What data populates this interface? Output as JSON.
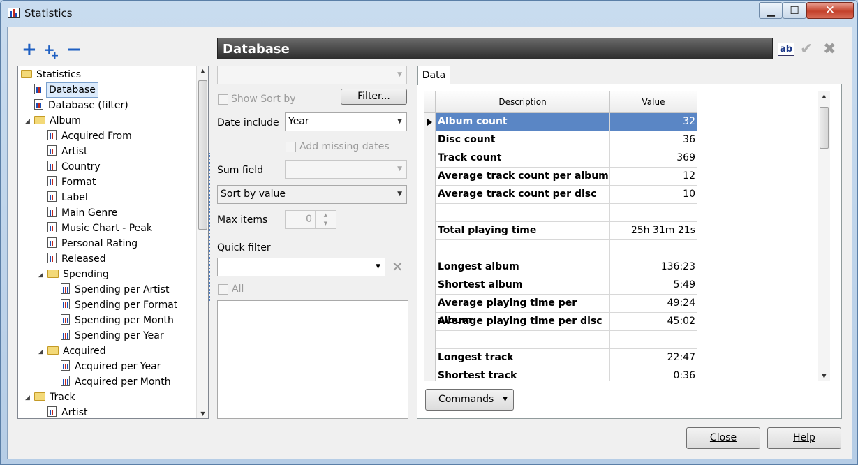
{
  "window": {
    "title": "Statistics"
  },
  "toolbar": {
    "add": "+",
    "add_sub": "+",
    "remove": "−"
  },
  "tree": {
    "items": [
      {
        "label": "Statistics",
        "level": 0,
        "type": "folder"
      },
      {
        "label": "Database",
        "level": 1,
        "type": "chart",
        "selected": true
      },
      {
        "label": "Database (filter)",
        "level": 1,
        "type": "chart"
      },
      {
        "label": "Album",
        "level": 1,
        "type": "folder"
      },
      {
        "label": "Acquired From",
        "level": 2,
        "type": "chart"
      },
      {
        "label": "Artist",
        "level": 2,
        "type": "chart"
      },
      {
        "label": "Country",
        "level": 2,
        "type": "chart"
      },
      {
        "label": "Format",
        "level": 2,
        "type": "chart"
      },
      {
        "label": "Label",
        "level": 2,
        "type": "chart"
      },
      {
        "label": "Main Genre",
        "level": 2,
        "type": "chart"
      },
      {
        "label": "Music Chart - Peak",
        "level": 2,
        "type": "chart"
      },
      {
        "label": "Personal Rating",
        "level": 2,
        "type": "chart"
      },
      {
        "label": "Released",
        "level": 2,
        "type": "chart"
      },
      {
        "label": "Spending",
        "level": 2,
        "type": "folder"
      },
      {
        "label": "Spending per Artist",
        "level": 3,
        "type": "chart"
      },
      {
        "label": "Spending per Format",
        "level": 3,
        "type": "chart"
      },
      {
        "label": "Spending per Month",
        "level": 3,
        "type": "chart"
      },
      {
        "label": "Spending per Year",
        "level": 3,
        "type": "chart"
      },
      {
        "label": "Acquired",
        "level": 2,
        "type": "folder"
      },
      {
        "label": "Acquired per Year",
        "level": 3,
        "type": "chart"
      },
      {
        "label": "Acquired per Month",
        "level": 3,
        "type": "chart"
      },
      {
        "label": "Track",
        "level": 1,
        "type": "folder"
      },
      {
        "label": "Artist",
        "level": 2,
        "type": "chart"
      }
    ]
  },
  "header": {
    "title": "Database"
  },
  "options": {
    "show_sort_by": "Show Sort by",
    "filter_button": "Filter...",
    "date_include_label": "Date include",
    "date_include_value": "Year",
    "add_missing_dates": "Add missing dates",
    "sum_field_label": "Sum field",
    "sort_value": "Sort by value",
    "max_items_label": "Max items",
    "max_items_value": "0",
    "quick_filter_label": "Quick filter",
    "all_label": "All"
  },
  "tab": {
    "label": "Data"
  },
  "grid": {
    "columns": [
      "Description",
      "Value"
    ],
    "rows": [
      {
        "description": "Album count",
        "value": "32"
      },
      {
        "description": "Disc count",
        "value": "36"
      },
      {
        "description": "Track count",
        "value": "369"
      },
      {
        "description": "Average track count per album",
        "value": "12"
      },
      {
        "description": "Average track count per disc",
        "value": "10"
      },
      {
        "description": "",
        "value": ""
      },
      {
        "description": "Total playing time",
        "value": "25h 31m 21s"
      },
      {
        "description": "",
        "value": ""
      },
      {
        "description": "Longest album",
        "value": "136:23"
      },
      {
        "description": "Shortest album",
        "value": "5:49"
      },
      {
        "description": "Average playing time per album",
        "value": "49:24"
      },
      {
        "description": "Average playing time per disc",
        "value": "45:02"
      },
      {
        "description": "",
        "value": ""
      },
      {
        "description": "Longest track",
        "value": "22:47"
      },
      {
        "description": "Shortest track",
        "value": "0:36"
      }
    ]
  },
  "commands_button": "Commands",
  "close_button": "Close",
  "help_button": "Help"
}
